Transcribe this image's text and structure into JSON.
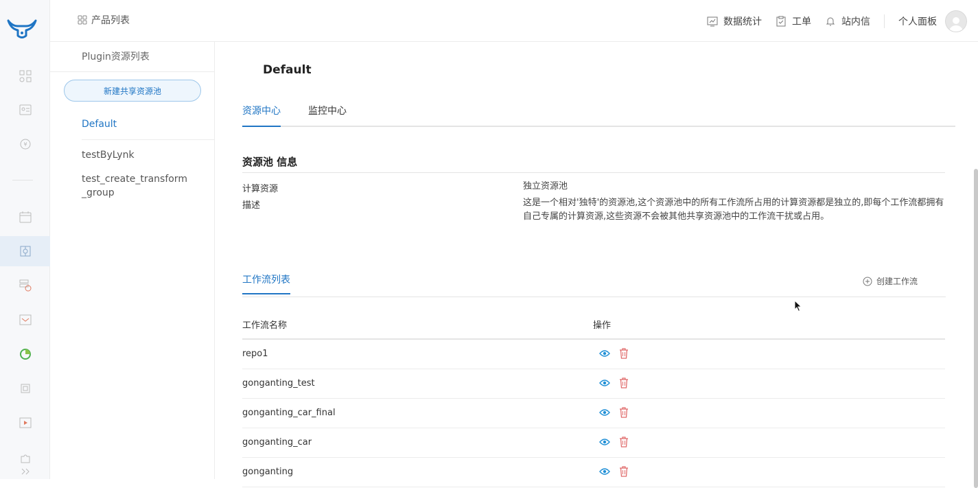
{
  "app": {
    "accent": "#1f75c4",
    "breadcrumb": "产品列表",
    "breadcrumb_icon": "grid-icon"
  },
  "topnav": {
    "stats_label": "数据统计",
    "ticket_label": "工单",
    "messages_label": "站内信",
    "profile_label": "个人面板"
  },
  "pools": {
    "header": "Plugin资源列表",
    "new_button": "新建共享资源池",
    "items": [
      {
        "label": "Default",
        "active": true
      },
      {
        "label": "testByLynk",
        "active": false
      },
      {
        "label": "test_create_transform\n_group",
        "active": false
      }
    ]
  },
  "main": {
    "title": "Default",
    "tabs": [
      {
        "label": "资源中心",
        "active": true
      },
      {
        "label": "监控中心",
        "active": false
      }
    ],
    "info": {
      "section_title": "资源池 信息",
      "compute_label": "计算资源",
      "compute_value": "独立资源池",
      "desc_label": "描述",
      "desc_value": "这是一个相对'独特'的资源池,这个资源池中的所有工作流所占用的计算资源都是独立的,即每个工作流都拥有自己专属的计算资源,这些资源不会被其他共享资源池中的工作流干扰或占用。"
    },
    "workflows": {
      "tab_label": "工作流列表",
      "create_label": "创建工作流",
      "col_name": "工作流名称",
      "col_ops": "操作",
      "rows": [
        "repo1",
        "gonganting_test",
        "gonganting_car_final",
        "gonganting_car",
        "gonganting"
      ]
    }
  }
}
